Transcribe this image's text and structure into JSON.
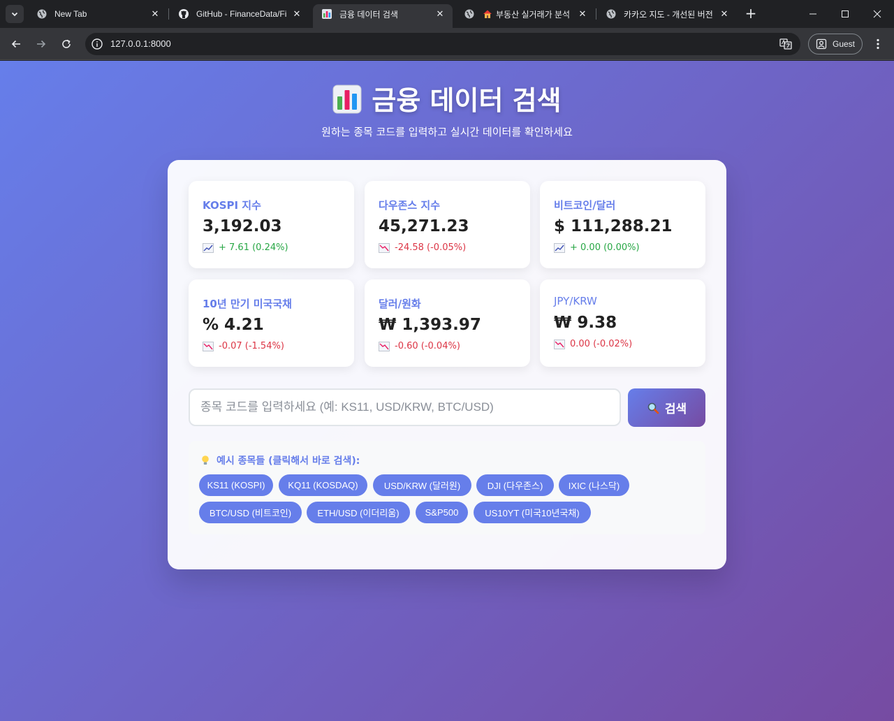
{
  "browser": {
    "tabs": [
      {
        "title": "New Tab",
        "favicon": "globe-icon"
      },
      {
        "title": "GitHub - FinanceData/FinanceDataReader",
        "favicon": "github-icon"
      },
      {
        "title": "금융 데이터 검색",
        "favicon": "bar-chart-icon"
      },
      {
        "title": "부동산 실거래가 분석",
        "favicon": "house-icon"
      },
      {
        "title": "카카오 지도 - 개선된 버전",
        "favicon": "globe-icon"
      }
    ],
    "active_tab": 2,
    "url": "127.0.0.1:8000",
    "profile_label": "Guest"
  },
  "page": {
    "title": "금융 데이터 검색",
    "subtitle": "원하는 종목 코드를 입력하고 실시간 데이터를 확인하세요"
  },
  "cards": [
    {
      "label": "KOSPI 지수",
      "value": "3,192.03",
      "change": "+ 7.61 (0.24%)",
      "direction": "up"
    },
    {
      "label": "다우존스 지수",
      "value": "45,271.23",
      "change": "-24.58 (-0.05%)",
      "direction": "down"
    },
    {
      "label": "비트코인/달러",
      "value": "$ 111,288.21",
      "change": "+ 0.00 (0.00%)",
      "direction": "up"
    },
    {
      "label": "10년 만기 미국국채",
      "value": "% 4.21",
      "change": "-0.07 (-1.54%)",
      "direction": "down"
    },
    {
      "label": "달러/원화",
      "value": "₩ 1,393.97",
      "change": "-0.60 (-0.04%)",
      "direction": "down"
    },
    {
      "label": "JPY/KRW",
      "value": "₩ 9.38",
      "change": "0.00 (-0.02%)",
      "direction": "down"
    }
  ],
  "search": {
    "placeholder": "종목 코드를 입력하세요 (예: KS11, USD/KRW, BTC/USD)",
    "value": "",
    "button_label": "검색"
  },
  "examples": {
    "title": "예시 종목들 (클릭해서 바로 검색):",
    "items": [
      "KS11 (KOSPI)",
      "KQ11 (KOSDAQ)",
      "USD/KRW (달러원)",
      "DJI (다우존스)",
      "IXIC (나스닥)",
      "BTC/USD (비트코인)",
      "ETH/USD (이더리움)",
      "S&P500",
      "US10YT (미국10년국채)"
    ]
  },
  "colors": {
    "accent": "#667eea",
    "gradient_end": "#764ba2",
    "up": "#28a745",
    "down": "#dc3545"
  }
}
